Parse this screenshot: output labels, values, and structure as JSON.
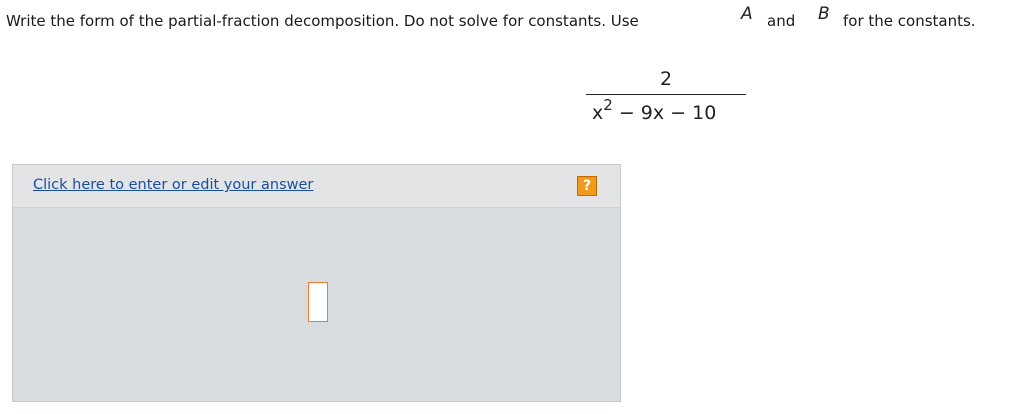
{
  "question": {
    "text_before": "Write the form of the partial-fraction decomposition. Do not solve for constants. Use",
    "var_a": "A",
    "text_and": "and",
    "var_b": "B",
    "text_after": "for the constants."
  },
  "fraction": {
    "numerator": "2",
    "den_base": "x",
    "den_exponent": "2",
    "den_rest": " − 9x − 10"
  },
  "answer": {
    "edit_link_label": "Click here to enter or edit your answer",
    "help_label": "?",
    "input_value": ""
  },
  "colors": {
    "link": "#1a4fa0",
    "help_button": "#f29a1f",
    "input_border": "#f07a32",
    "panel_bg": "#d8dcdf"
  }
}
